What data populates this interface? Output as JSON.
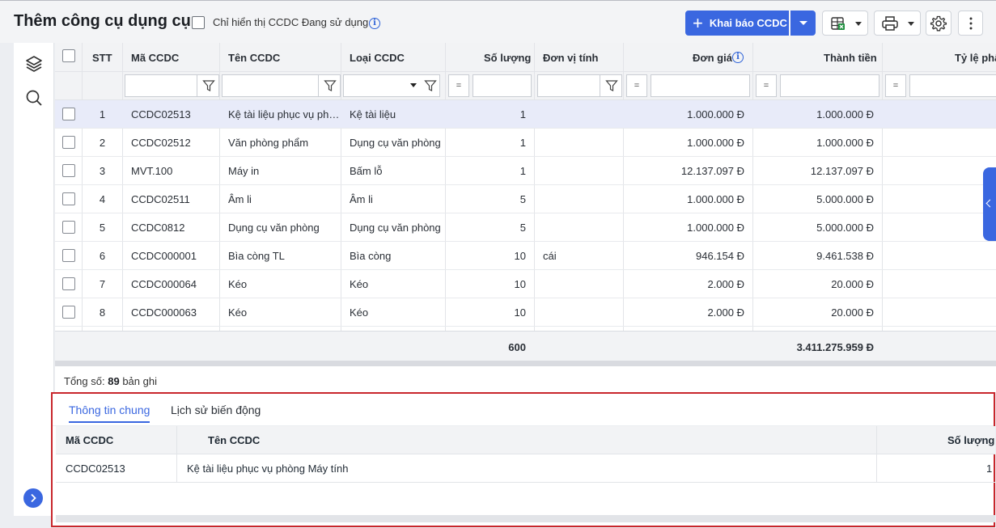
{
  "header": {
    "title": "Thêm công cụ dụng cụ",
    "filter_label": "Chỉ hiển thị CCDC Đang sử dụng",
    "info_glyph": "i",
    "primary_button": "Khai báo CCDC",
    "icons": [
      "plus-icon",
      "chevron-down-icon",
      "excel-icon",
      "print-icon",
      "gear-icon",
      "more-vertical-icon"
    ]
  },
  "sidebar": {
    "icons": [
      "layers-icon",
      "search-icon",
      "chevron-right-icon"
    ]
  },
  "grid": {
    "columns": {
      "stt": "STT",
      "code": "Mã CCDC",
      "name": "Tên CCDC",
      "type": "Loại CCDC",
      "qty": "Số lượng",
      "unit": "Đơn vị tính",
      "price": "Đơn giá",
      "amount": "Thành tiền",
      "ratio": "Tỷ lệ phâ"
    },
    "eq_sign": "=",
    "rows": [
      {
        "stt": "1",
        "code": "CCDC02513",
        "name": "Kệ tài liệu phục vụ phòng Máy tính",
        "type": "Kệ tài liệu",
        "qty": "1",
        "unit": "",
        "price": "1.000.000 Đ",
        "amount": "1.000.000 Đ"
      },
      {
        "stt": "2",
        "code": "CCDC02512",
        "name": "Văn phòng phẩm",
        "type": "Dụng cụ văn phòng",
        "qty": "1",
        "unit": "",
        "price": "1.000.000 Đ",
        "amount": "1.000.000 Đ"
      },
      {
        "stt": "3",
        "code": "MVT.100",
        "name": "Máy in",
        "type": "Bấm lỗ",
        "qty": "1",
        "unit": "",
        "price": "12.137.097 Đ",
        "amount": "12.137.097 Đ"
      },
      {
        "stt": "4",
        "code": "CCDC02511",
        "name": "Âm li",
        "type": "Âm li",
        "qty": "5",
        "unit": "",
        "price": "1.000.000 Đ",
        "amount": "5.000.000 Đ"
      },
      {
        "stt": "5",
        "code": "CCDC0812",
        "name": "Dụng cụ văn phòng",
        "type": "Dụng cụ văn phòng",
        "qty": "5",
        "unit": "",
        "price": "1.000.000 Đ",
        "amount": "5.000.000 Đ"
      },
      {
        "stt": "6",
        "code": "CCDC000001",
        "name": "Bìa còng TL",
        "type": "Bìa còng",
        "qty": "10",
        "unit": "cái",
        "price": "946.154 Đ",
        "amount": "9.461.538 Đ"
      },
      {
        "stt": "7",
        "code": "CCDC000064",
        "name": "Kéo",
        "type": "Kéo",
        "qty": "10",
        "unit": "",
        "price": "2.000 Đ",
        "amount": "20.000 Đ"
      },
      {
        "stt": "8",
        "code": "CCDC000063",
        "name": "Kéo",
        "type": "Kéo",
        "qty": "10",
        "unit": "",
        "price": "2.000 Đ",
        "amount": "20.000 Đ"
      }
    ],
    "summary": {
      "qty": "600",
      "amount": "3.411.275.959 Đ"
    }
  },
  "total": {
    "prefix": "Tổng số:",
    "count": "89",
    "suffix": "bản ghi"
  },
  "detail": {
    "tabs": [
      "Thông tin chung",
      "Lịch sử biến động"
    ],
    "columns": {
      "code": "Mã CCDC",
      "name": "Tên CCDC",
      "qty": "Số lượng"
    },
    "row": {
      "code": "CCDC02513",
      "name": "Kệ tài liệu phục vụ phòng Máy tính",
      "qty": "1"
    }
  },
  "colors": {
    "accent": "#3a67e0",
    "highlight_border": "#c8262c",
    "selected_row": "#e8ebf9"
  }
}
